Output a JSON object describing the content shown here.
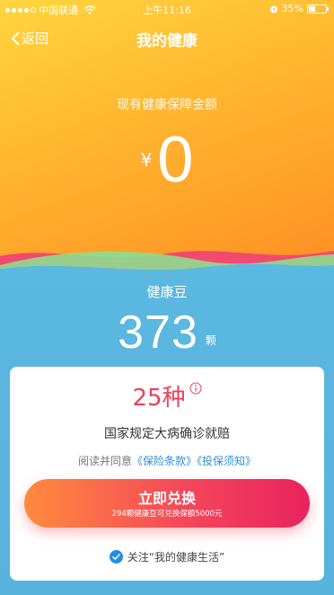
{
  "status_bar": {
    "carrier": "中国联通",
    "time": "上午11:16",
    "battery": "35%",
    "battery_level": 0.35
  },
  "nav": {
    "back_label": "返回",
    "title": "我的健康"
  },
  "insurance": {
    "label": "现有健康保障金额",
    "currency": "¥",
    "amount": "0"
  },
  "beans": {
    "label": "健康豆",
    "count": "373",
    "unit": "颗"
  },
  "card": {
    "disease_count": "25种",
    "claim_text": "国家规定大病确诊就赔",
    "agree_prefix": "阅读并同意",
    "terms_link": "《保险条款》",
    "notice_link": "《投保须知》",
    "redeem_title": "立即兑换",
    "redeem_subtitle": "294颗健康豆可兑换保额5000元",
    "follow_text": "关注“我的健康生活”",
    "follow_checked": true
  },
  "colors": {
    "accent_red": "#ee3f5a",
    "link_blue": "#2e8fd8",
    "check_blue": "#1f8ee8"
  }
}
